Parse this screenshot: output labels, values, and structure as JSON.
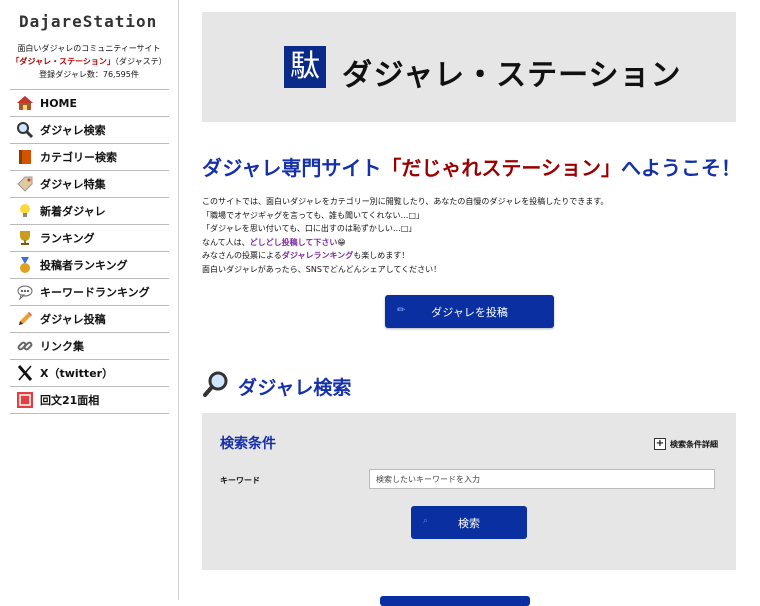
{
  "site": {
    "logo": "DajareStation",
    "tagline": "面白いダジャレのコミュニティーサイト",
    "name_strong": "「ダジャレ・ステーション」",
    "name_short": "（ダジャステ）",
    "registered_count": "登録ダジャレ数：76,595件"
  },
  "nav": {
    "items": [
      {
        "label": "HOME",
        "icon": "house-icon"
      },
      {
        "label": "ダジャレ検索",
        "icon": "magnifier-icon"
      },
      {
        "label": "カテゴリー検索",
        "icon": "book-icon"
      },
      {
        "label": "ダジャレ特集",
        "icon": "tag-icon"
      },
      {
        "label": "新着ダジャレ",
        "icon": "lightbulb-icon"
      },
      {
        "label": "ランキング",
        "icon": "trophy-icon"
      },
      {
        "label": "投稿者ランキング",
        "icon": "medal-icon"
      },
      {
        "label": "キーワードランキング",
        "icon": "speech-bubble-icon"
      },
      {
        "label": "ダジャレ投稿",
        "icon": "pencil-icon"
      },
      {
        "label": "リンク集",
        "icon": "link-icon"
      },
      {
        "label": "X（twitter）",
        "icon": "x-logo-icon"
      },
      {
        "label": "回文21面相",
        "icon": "kaibun-icon"
      }
    ]
  },
  "header": {
    "badge": "駄",
    "title": "ダジャレ・ステーション"
  },
  "welcome": {
    "pre": "ダジャレ専門サイト",
    "accent": "「だじゃれステーション」",
    "post": "へようこそ！"
  },
  "intro": {
    "line1": "このサイトでは、面白いダジャレをカテゴリー別に閲覧したり、あなたの自慢のダジャレを投稿したりできます。",
    "line2": "「職場でオヤジギャグを言っても、誰も聞いてくれない…□」",
    "line3": "「ダジャレを思い付いても、口に出すのは恥ずかしい…□」",
    "line4_pre": "なんて人は、",
    "line4_link": "どしどし投稿して下さい",
    "line4_post": "😁",
    "line5_pre": "みなさんの投票による",
    "line5_link": "ダジャレランキング",
    "line5_post": "も楽しめます！",
    "line6": "面白いダジャレがあったら、SNSでどんどんシェアしてください！"
  },
  "post_button": {
    "label": "ダジャレを投稿",
    "icon": "pencil-icon"
  },
  "search": {
    "heading": "ダジャレ検索",
    "heading_icon": "magnifier-icon",
    "conditions_title": "検索条件",
    "detail_label": "検索条件詳細",
    "keyword_label": "キーワード",
    "keyword_placeholder": "検索したいキーワードを入力",
    "button_label": "検索",
    "button_icon": "search-icon"
  },
  "colors": {
    "brand_blue": "#0a2fa0",
    "heading_blue": "#1530a8",
    "accent_red": "#9a0000",
    "panel_gray": "#e6e6e6"
  }
}
